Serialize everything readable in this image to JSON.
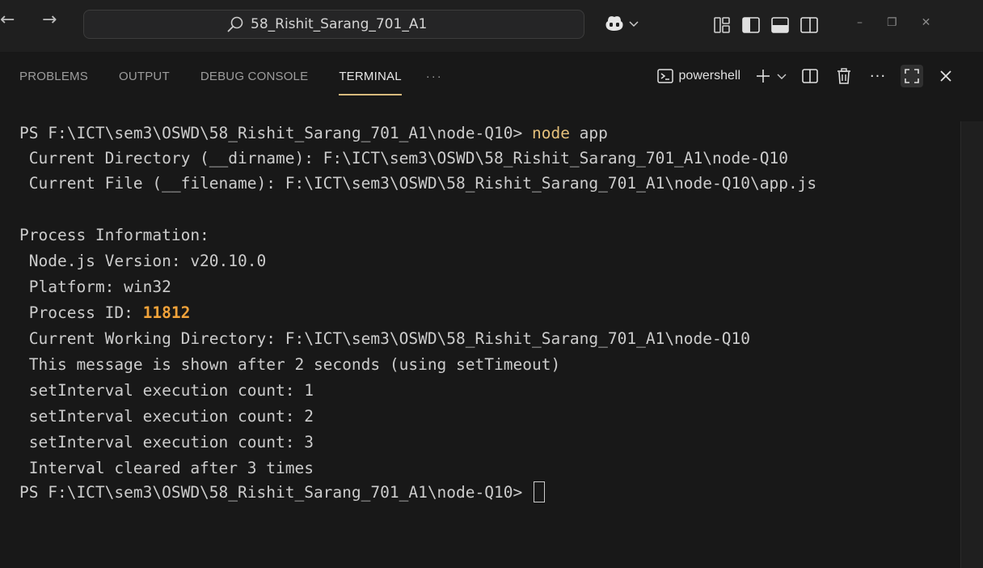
{
  "titlebar": {
    "search_text": "58_Rishit_Sarang_701_A1"
  },
  "panel": {
    "tabs": [
      {
        "label": "PROBLEMS"
      },
      {
        "label": "OUTPUT"
      },
      {
        "label": "DEBUG CONSOLE"
      },
      {
        "label": "TERMINAL"
      }
    ],
    "more_label": "···",
    "shell_label": "powershell",
    "accent_color": "#d7ba7d"
  },
  "terminal": {
    "prompt1": "PS F:\\ICT\\sem3\\OSWD\\58_Rishit_Sarang_701_A1\\node-Q10> ",
    "cmd_node": "node",
    "cmd_arg": " app",
    "line_dirname": " Current Directory (__dirname): F:\\ICT\\sem3\\OSWD\\58_Rishit_Sarang_701_A1\\node-Q10",
    "line_filename": " Current File (__filename): F:\\ICT\\sem3\\OSWD\\58_Rishit_Sarang_701_A1\\node-Q10\\app.js",
    "line_procinfo": "Process Information:",
    "line_nodever": " Node.js Version: v20.10.0",
    "line_platform": " Platform: win32",
    "line_pid_label": " Process ID: ",
    "line_pid_value": "11812",
    "line_cwd": " Current Working Directory: F:\\ICT\\sem3\\OSWD\\58_Rishit_Sarang_701_A1\\node-Q10",
    "line_timeout": " This message is shown after 2 seconds (using setTimeout)",
    "line_int1": " setInterval execution count: 1",
    "line_int2": " setInterval execution count: 2",
    "line_int3": " setInterval execution count: 3",
    "line_cleared": " Interval cleared after 3 times",
    "prompt2": "PS F:\\ICT\\sem3\\OSWD\\58_Rishit_Sarang_701_A1\\node-Q10> "
  }
}
